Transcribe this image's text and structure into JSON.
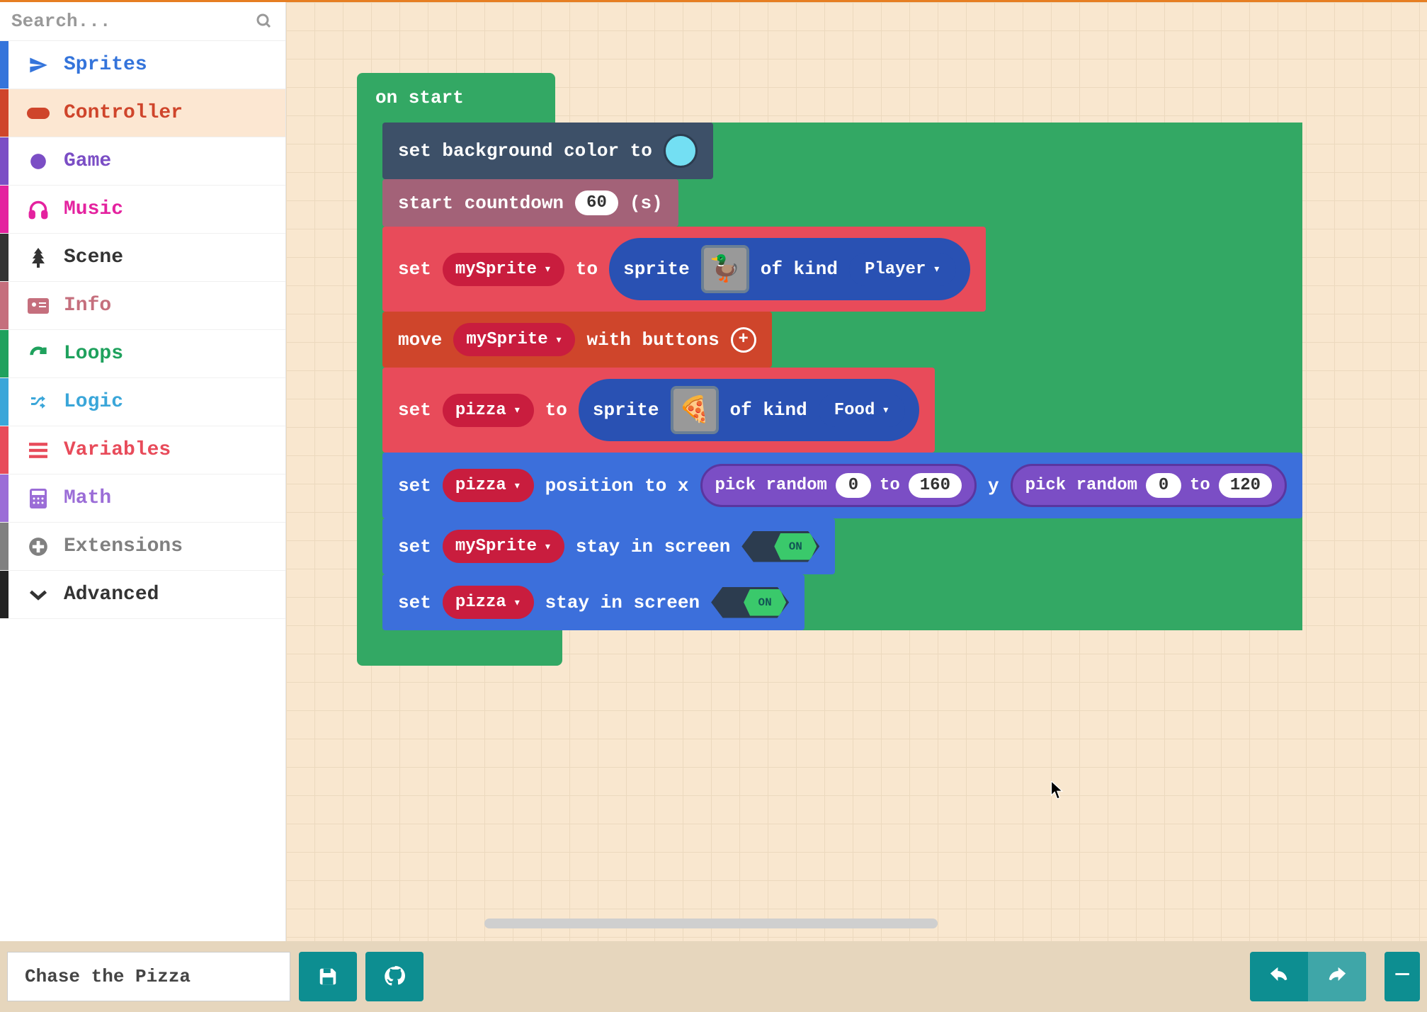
{
  "search": {
    "placeholder": "Search..."
  },
  "categories": [
    {
      "label": "Sprites",
      "color": "#3474db",
      "icon": "paper-plane"
    },
    {
      "label": "Controller",
      "color": "#cf452b",
      "icon": "gamepad"
    },
    {
      "label": "Game",
      "color": "#7b4ec5",
      "icon": "circle"
    },
    {
      "label": "Music",
      "color": "#e4229f",
      "icon": "headphones"
    },
    {
      "label": "Scene",
      "color": "#333333",
      "icon": "tree"
    },
    {
      "label": "Info",
      "color": "#c56f7d",
      "icon": "id-card"
    },
    {
      "label": "Loops",
      "color": "#1fa15d",
      "icon": "redo"
    },
    {
      "label": "Logic",
      "color": "#3aa6d9",
      "icon": "shuffle"
    },
    {
      "label": "Variables",
      "color": "#e84b5a",
      "icon": "list"
    },
    {
      "label": "Math",
      "color": "#9b6dd7",
      "icon": "calculator"
    },
    {
      "label": "Extensions",
      "color": "#808080",
      "icon": "plus-circle"
    }
  ],
  "advanced_label": "Advanced",
  "hat": {
    "label": "on start"
  },
  "blk_bg": {
    "text": "set background color to",
    "color": "#73dff3"
  },
  "blk_countdown": {
    "text1": "start countdown",
    "value": "60",
    "text2": "(s)"
  },
  "blk_setMySprite": {
    "text1": "set",
    "var": "mySprite",
    "text2": "to",
    "inner1": "sprite",
    "inner2": "of kind",
    "kind": "Player",
    "emoji": "🦆"
  },
  "blk_move": {
    "text1": "move",
    "var": "mySprite",
    "text2": "with buttons"
  },
  "blk_setPizza": {
    "text1": "set",
    "var": "pizza",
    "text2": "to",
    "inner1": "sprite",
    "inner2": "of kind",
    "kind": "Food",
    "emoji": "🍕"
  },
  "blk_pos": {
    "text1": "set",
    "var": "pizza",
    "text2": "position to x",
    "rand": "pick random",
    "x0": "0",
    "to": "to",
    "x1": "160",
    "y": "y",
    "y0": "0",
    "y1": "120"
  },
  "blk_stay1": {
    "text1": "set",
    "var": "mySprite",
    "text2": "stay in screen",
    "on": "ON"
  },
  "blk_stay2": {
    "text1": "set",
    "var": "pizza",
    "text2": "stay in screen",
    "on": "ON"
  },
  "project_name": "Chase the Pizza"
}
